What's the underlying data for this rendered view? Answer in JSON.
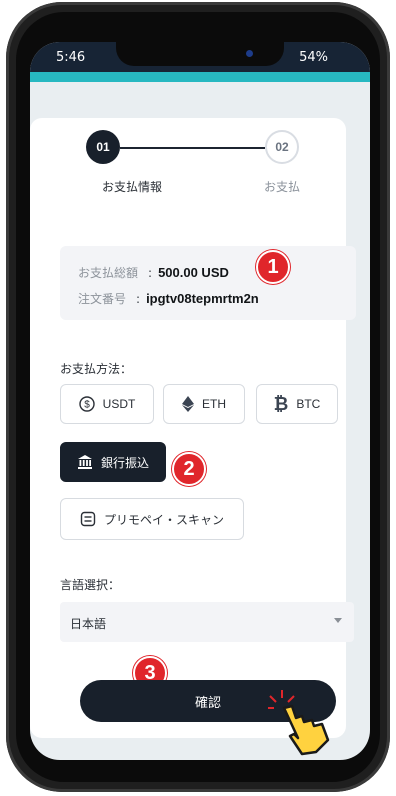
{
  "status_bar": {
    "time": "5:46",
    "battery": "54%"
  },
  "steps": [
    {
      "number": "01",
      "label": "お支払情報"
    },
    {
      "number": "02",
      "label": "お支払"
    }
  ],
  "summary": {
    "total_label": "お支払総額",
    "total_value": "500.00 USD",
    "order_label": "注文番号",
    "order_value": "ipgtv08tepmrtm2n",
    "colon": ":"
  },
  "payment": {
    "section_label": "お支払方法：",
    "options": [
      {
        "label": "USDT",
        "icon": "usdt-icon"
      },
      {
        "label": "ETH",
        "icon": "ethereum-icon"
      },
      {
        "label": "BTC",
        "icon": "bitcoin-icon"
      },
      {
        "label": "銀行振込",
        "icon": "bank-icon",
        "selected": true
      },
      {
        "label": "プリモペイ・スキャン",
        "icon": "scan-icon"
      }
    ]
  },
  "language": {
    "section_label": "言語選択：",
    "selected": "日本語"
  },
  "confirm_label": "確認",
  "annotations": [
    "1",
    "2",
    "3"
  ],
  "colors": {
    "primary": "#18202b",
    "accent": "#27b8c1",
    "badge": "#e0262b"
  }
}
